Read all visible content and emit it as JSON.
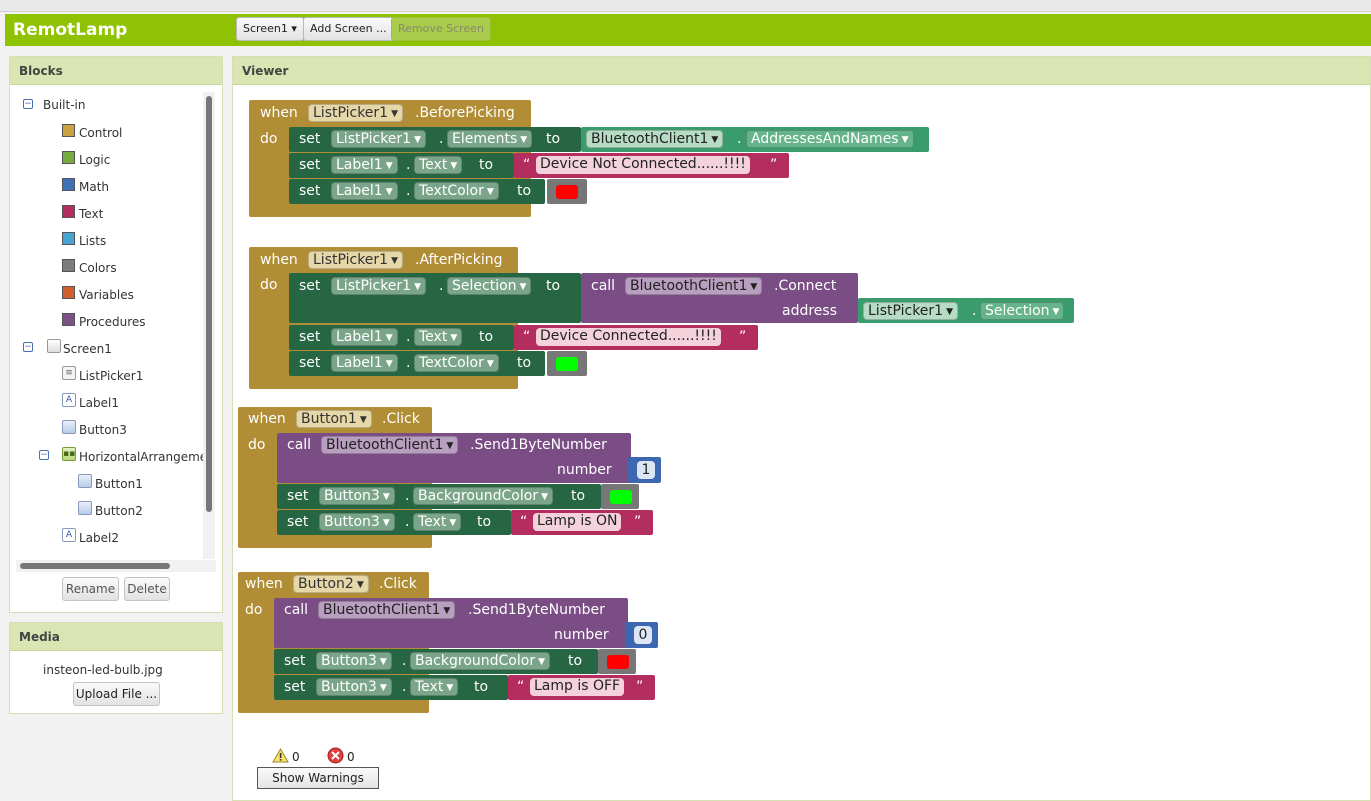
{
  "app": {
    "name": "RemotLamp"
  },
  "toolbar": {
    "screen_select": "Screen1",
    "add_screen": "Add Screen ...",
    "remove_screen": "Remove Screen"
  },
  "blocks_panel": {
    "title": "Blocks",
    "builtin_label": "Built-in",
    "builtin_items": [
      {
        "label": "Control",
        "color": "#c9a341"
      },
      {
        "label": "Logic",
        "color": "#77ab41"
      },
      {
        "label": "Math",
        "color": "#3f71b5"
      },
      {
        "label": "Text",
        "color": "#b32d5e"
      },
      {
        "label": "Lists",
        "color": "#49a6d4"
      },
      {
        "label": "Colors",
        "color": "#7d7d7d"
      },
      {
        "label": "Variables",
        "color": "#d05f2d"
      },
      {
        "label": "Procedures",
        "color": "#7c5385"
      }
    ],
    "screen_label": "Screen1",
    "components": [
      "ListPicker1",
      "Label1",
      "Button3",
      "HorizontalArrangement",
      "Button1",
      "Button2",
      "Label2"
    ],
    "rename": "Rename",
    "delete": "Delete"
  },
  "media_panel": {
    "title": "Media",
    "file": "insteon-led-bulb.jpg",
    "upload": "Upload File ..."
  },
  "viewer": {
    "title": "Viewer",
    "warnings_count": "0",
    "errors_count": "0",
    "show_warnings": "Show Warnings"
  },
  "blocks": {
    "b1": {
      "when": "when",
      "component": "ListPicker1",
      "event": ".BeforePicking",
      "do": "do",
      "set": "set",
      "to": "to",
      "dot": ".",
      "r1_comp": "ListPicker1",
      "r1_prop": "Elements",
      "r1_val_comp": "BluetoothClient1",
      "r1_val_prop": "AddressesAndNames",
      "r2_comp": "Label1",
      "r2_prop": "Text",
      "r2_text": "Device Not Connected......!!!!",
      "r3_comp": "Label1",
      "r3_prop": "TextColor",
      "r3_color": "#ff0000"
    },
    "b2": {
      "when": "when",
      "component": "ListPicker1",
      "event": ".AfterPicking",
      "do": "do",
      "set": "set",
      "to": "to",
      "dot": ".",
      "call": "call",
      "address": "address",
      "r1_comp": "ListPicker1",
      "r1_prop": "Selection",
      "r1_call_comp": "BluetoothClient1",
      "r1_method": ".Connect",
      "r1_arg_comp": "ListPicker1",
      "r1_arg_prop": "Selection",
      "r2_comp": "Label1",
      "r2_prop": "Text",
      "r2_text": "Device Connected......!!!!",
      "r3_comp": "Label1",
      "r3_prop": "TextColor",
      "r3_color": "#00ff00"
    },
    "b3": {
      "when": "when",
      "component": "Button1",
      "event": ".Click",
      "do": "do",
      "call": "call",
      "call_comp": "BluetoothClient1",
      "method": ".Send1ByteNumber",
      "number": "number",
      "num_value": "1",
      "set": "set",
      "to": "to",
      "dot": ".",
      "r2_comp": "Button3",
      "r2_prop": "BackgroundColor",
      "r2_color": "#00ff00",
      "r3_comp": "Button3",
      "r3_prop": "Text",
      "r3_text": "Lamp is ON"
    },
    "b4": {
      "when": "when",
      "component": "Button2",
      "event": ".Click",
      "do": "do",
      "call": "call",
      "call_comp": "BluetoothClient1",
      "method": ".Send1ByteNumber",
      "number": "number",
      "num_value": "0",
      "set": "set",
      "to": "to",
      "dot": ".",
      "r2_comp": "Button3",
      "r2_prop": "BackgroundColor",
      "r2_color": "#ff0000",
      "r3_comp": "Button3",
      "r3_prop": "Text",
      "r3_text": "Lamp is OFF"
    }
  },
  "quote_open": "“",
  "quote_close": "”"
}
